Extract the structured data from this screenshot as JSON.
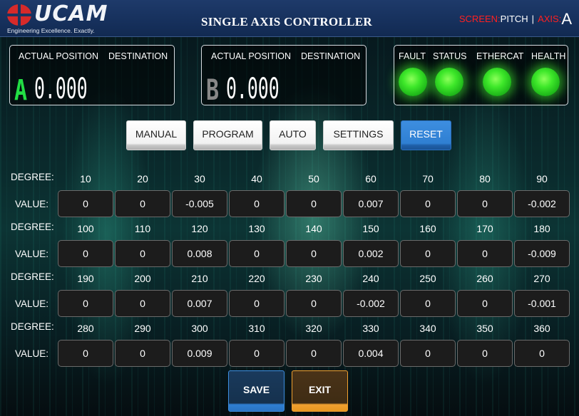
{
  "header": {
    "logo_text": "UCAM",
    "logo_tagline": "Engineering Excellence. Exactly.",
    "title": "SINGLE AXIS CONTROLLER",
    "screen_label": "SCREEN:",
    "screen_value": "PITCH",
    "separator": "|",
    "axis_label": "AXIS:",
    "axis_value": "A"
  },
  "panel_a": {
    "actual_label": "ACTUAL POSITION",
    "dest_label": "DESTINATION",
    "axis_letter": "A",
    "position": "0.000"
  },
  "panel_b": {
    "actual_label": "ACTUAL POSITION",
    "dest_label": "DESTINATION",
    "axis_letter": "B",
    "position": "0.000"
  },
  "status_panel": {
    "labels": [
      "FAULT",
      "STATUS",
      "ETHERCAT",
      "HEALTH"
    ],
    "led_color": "#3ee82a"
  },
  "mode_buttons": {
    "manual": "MANUAL",
    "program": "PROGRAM",
    "auto": "AUTO",
    "settings": "SETTINGS",
    "reset": "RESET"
  },
  "grid": {
    "degree_label": "DEGREE:",
    "value_label": "VALUE:",
    "rows": [
      {
        "degrees": [
          "10",
          "20",
          "30",
          "40",
          "50",
          "60",
          "70",
          "80",
          "90"
        ],
        "values": [
          "0",
          "0",
          "-0.005",
          "0",
          "0",
          "0.007",
          "0",
          "0",
          "-0.002"
        ]
      },
      {
        "degrees": [
          "100",
          "110",
          "120",
          "130",
          "140",
          "150",
          "160",
          "170",
          "180"
        ],
        "values": [
          "0",
          "0",
          "0.008",
          "0",
          "0",
          "0.002",
          "0",
          "0",
          "-0.009"
        ]
      },
      {
        "degrees": [
          "190",
          "200",
          "210",
          "220",
          "230",
          "240",
          "250",
          "260",
          "270"
        ],
        "values": [
          "0",
          "0",
          "0.007",
          "0",
          "0",
          "-0.002",
          "0",
          "0",
          "-0.001"
        ]
      },
      {
        "degrees": [
          "280",
          "290",
          "300",
          "310",
          "320",
          "330",
          "340",
          "350",
          "360"
        ],
        "values": [
          "0",
          "0",
          "0.009",
          "0",
          "0",
          "0.004",
          "0",
          "0",
          "0"
        ]
      }
    ]
  },
  "actions": {
    "save": "SAVE",
    "exit": "EXIT"
  }
}
